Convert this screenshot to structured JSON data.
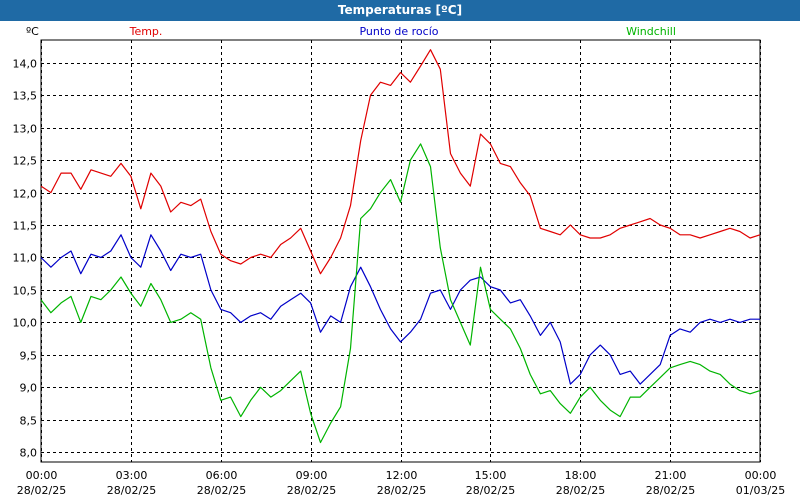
{
  "window": {
    "title": "Temperaturas [ºC]"
  },
  "chart_data": {
    "type": "line",
    "title": "Temperaturas [ºC]",
    "ylabel": "ºC",
    "ylim": [
      7.85,
      14.35
    ],
    "yticks": [
      "8,0",
      "8,5",
      "9,0",
      "9,5",
      "10,0",
      "10,5",
      "11,0",
      "11,5",
      "12,0",
      "12,5",
      "13,0",
      "13,5",
      "14,0"
    ],
    "x_ticks": [
      {
        "time": "00:00",
        "date": "28/02/25"
      },
      {
        "time": "03:00",
        "date": "28/02/25"
      },
      {
        "time": "06:00",
        "date": "28/02/25"
      },
      {
        "time": "09:00",
        "date": "28/02/25"
      },
      {
        "time": "12:00",
        "date": "28/02/25"
      },
      {
        "time": "15:00",
        "date": "28/02/25"
      },
      {
        "time": "18:00",
        "date": "28/02/25"
      },
      {
        "time": "21:00",
        "date": "28/02/25"
      },
      {
        "time": "00:00",
        "date": "01/03/25"
      }
    ],
    "x_hours": [
      0,
      0.33,
      0.67,
      1,
      1.33,
      1.67,
      2,
      2.33,
      2.67,
      3,
      3.33,
      3.67,
      4,
      4.33,
      4.67,
      5,
      5.33,
      5.67,
      6,
      6.33,
      6.67,
      7,
      7.33,
      7.67,
      8,
      8.33,
      8.67,
      9,
      9.33,
      9.67,
      10,
      10.33,
      10.67,
      11,
      11.33,
      11.67,
      12,
      12.33,
      12.67,
      13,
      13.33,
      13.67,
      14,
      14.33,
      14.67,
      15,
      15.33,
      15.67,
      16,
      16.33,
      16.67,
      17,
      17.33,
      17.67,
      18,
      18.33,
      18.67,
      19,
      19.33,
      19.67,
      20,
      20.33,
      20.67,
      21,
      21.33,
      21.67,
      22,
      22.33,
      22.67,
      23,
      23.33,
      23.67,
      24
    ],
    "grid": true,
    "legend_position": "top",
    "series": [
      {
        "name": "Temp.",
        "color": "#e00000",
        "values": [
          12.1,
          12.0,
          12.3,
          12.3,
          12.05,
          12.35,
          12.3,
          12.25,
          12.45,
          12.25,
          11.75,
          12.3,
          12.1,
          11.7,
          11.85,
          11.8,
          11.9,
          11.4,
          11.05,
          10.95,
          10.9,
          11.0,
          11.05,
          11.0,
          11.2,
          11.3,
          11.45,
          11.1,
          10.75,
          11.0,
          11.3,
          11.8,
          12.8,
          13.5,
          13.7,
          13.65,
          13.85,
          13.7,
          13.95,
          14.2,
          13.9,
          12.6,
          12.3,
          12.1,
          12.9,
          12.75,
          12.45,
          12.4,
          12.15,
          11.95,
          11.45,
          11.4,
          11.35,
          11.5,
          11.35,
          11.3,
          11.3,
          11.35,
          11.45,
          11.5,
          11.55,
          11.6,
          11.5,
          11.45,
          11.35,
          11.35,
          11.3,
          11.35,
          11.4,
          11.45,
          11.4,
          11.3,
          11.35
        ]
      },
      {
        "name": "Punto de rocío",
        "color": "#0000c8",
        "values": [
          11.0,
          10.85,
          11.0,
          11.1,
          10.75,
          11.05,
          11.0,
          11.1,
          11.35,
          11.0,
          10.85,
          11.35,
          11.1,
          10.8,
          11.05,
          11.0,
          11.05,
          10.5,
          10.2,
          10.15,
          10.0,
          10.1,
          10.15,
          10.05,
          10.25,
          10.35,
          10.45,
          10.3,
          9.85,
          10.1,
          10.0,
          10.55,
          10.85,
          10.55,
          10.2,
          9.9,
          9.7,
          9.85,
          10.05,
          10.45,
          10.5,
          10.2,
          10.5,
          10.65,
          10.7,
          10.55,
          10.5,
          10.3,
          10.35,
          10.1,
          9.8,
          10.0,
          9.7,
          9.05,
          9.2,
          9.5,
          9.65,
          9.5,
          9.2,
          9.25,
          9.05,
          9.2,
          9.35,
          9.8,
          9.9,
          9.85,
          10.0,
          10.05,
          10.0,
          10.05,
          10.0,
          10.05,
          10.05
        ]
      },
      {
        "name": "Windchill",
        "color": "#00b400",
        "values": [
          10.35,
          10.15,
          10.3,
          10.4,
          10.0,
          10.4,
          10.35,
          10.5,
          10.7,
          10.45,
          10.25,
          10.6,
          10.35,
          10.0,
          10.05,
          10.15,
          10.05,
          9.3,
          8.8,
          8.85,
          8.55,
          8.8,
          9.0,
          8.85,
          8.95,
          9.1,
          9.25,
          8.6,
          8.15,
          8.45,
          8.7,
          9.6,
          11.6,
          11.75,
          12.0,
          12.2,
          11.85,
          12.5,
          12.75,
          12.4,
          11.15,
          10.35,
          10.0,
          9.65,
          10.85,
          10.2,
          10.05,
          9.9,
          9.6,
          9.2,
          8.9,
          8.95,
          8.75,
          8.6,
          8.85,
          9.0,
          8.8,
          8.65,
          8.55,
          8.85,
          8.85,
          9.0,
          9.15,
          9.3,
          9.35,
          9.4,
          9.35,
          9.25,
          9.2,
          9.05,
          8.95,
          8.9,
          8.95
        ]
      }
    ]
  }
}
